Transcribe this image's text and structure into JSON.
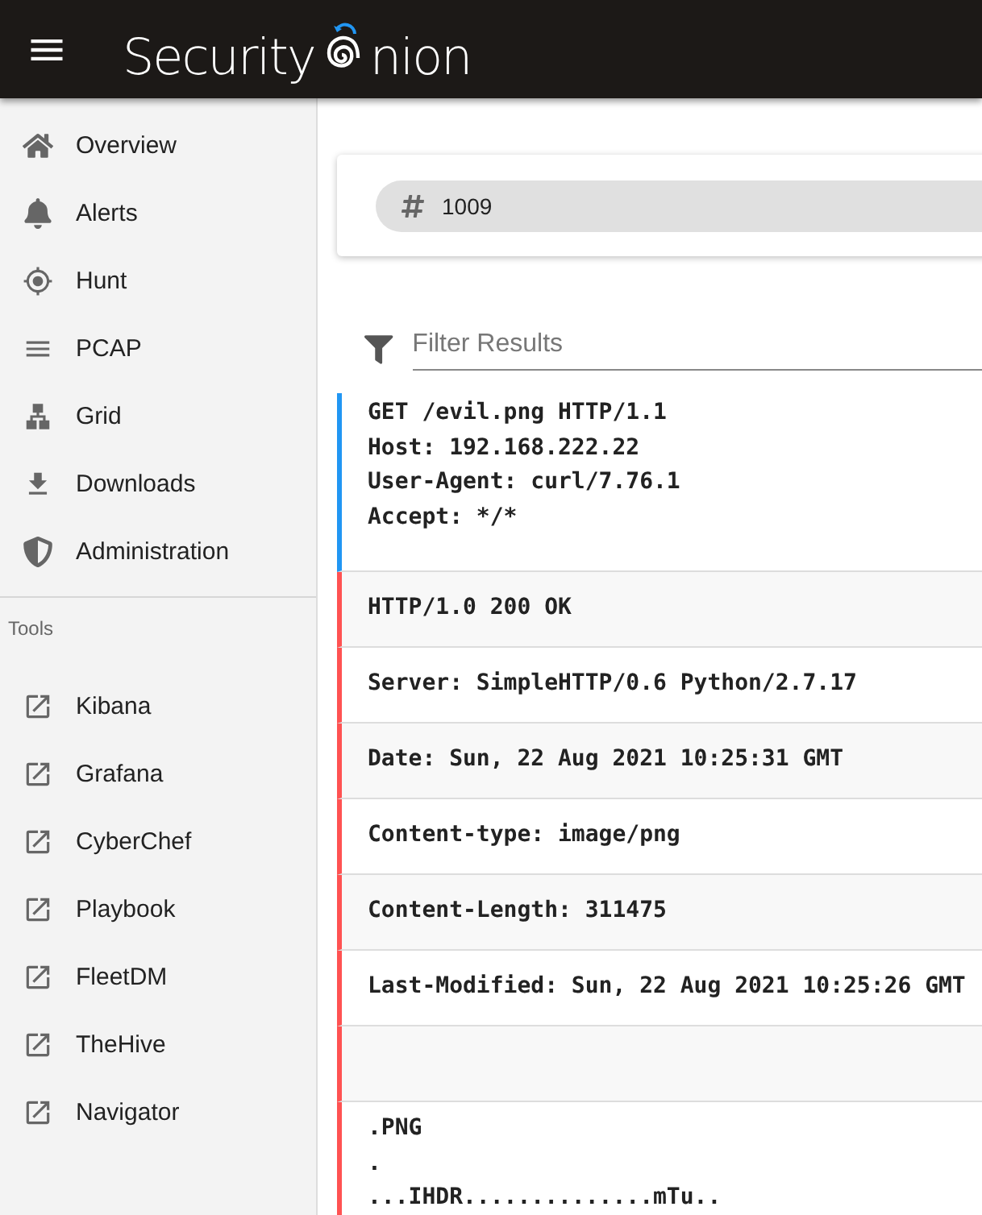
{
  "header": {
    "logo_start": "Security",
    "logo_end": "nion"
  },
  "sidebar": {
    "items": [
      {
        "label": "Overview"
      },
      {
        "label": "Alerts"
      },
      {
        "label": "Hunt"
      },
      {
        "label": "PCAP"
      },
      {
        "label": "Grid"
      },
      {
        "label": "Downloads"
      },
      {
        "label": "Administration"
      }
    ],
    "section": "Tools",
    "tools": [
      {
        "label": "Kibana"
      },
      {
        "label": "Grafana"
      },
      {
        "label": "CyberChef"
      },
      {
        "label": "Playbook"
      },
      {
        "label": "FleetDM"
      },
      {
        "label": "TheHive"
      },
      {
        "label": "Navigator"
      }
    ]
  },
  "job": {
    "id": "1009"
  },
  "filter": {
    "placeholder": "Filter Results"
  },
  "transcript": [
    {
      "kind": "request",
      "color": "#2196f3",
      "lines": [
        "GET /evil.png HTTP/1.1",
        "Host: 192.168.222.22",
        "User-Agent: curl/7.76.1",
        "Accept: */*"
      ]
    },
    {
      "kind": "header",
      "color": "#ff5252",
      "lines": [
        "HTTP/1.0 200 OK"
      ]
    },
    {
      "kind": "header",
      "color": "#ff5252",
      "lines": [
        "Server: SimpleHTTP/0.6 Python/2.7.17"
      ]
    },
    {
      "kind": "header",
      "color": "#ff5252",
      "lines": [
        "Date: Sun, 22 Aug 2021 10:25:31 GMT"
      ]
    },
    {
      "kind": "header",
      "color": "#ff5252",
      "lines": [
        "Content-type: image/png"
      ]
    },
    {
      "kind": "header",
      "color": "#ff5252",
      "lines": [
        "Content-Length: 311475"
      ]
    },
    {
      "kind": "header",
      "color": "#ff5252",
      "lines": [
        "Last-Modified: Sun, 22 Aug 2021 10:25:26 GMT"
      ]
    },
    {
      "kind": "blank",
      "color": "#ff5252"
    },
    {
      "kind": "payload",
      "color": "#ff5252",
      "lines": [
        ".PNG",
        ".",
        "...IHDR..............mTu.."
      ]
    }
  ]
}
